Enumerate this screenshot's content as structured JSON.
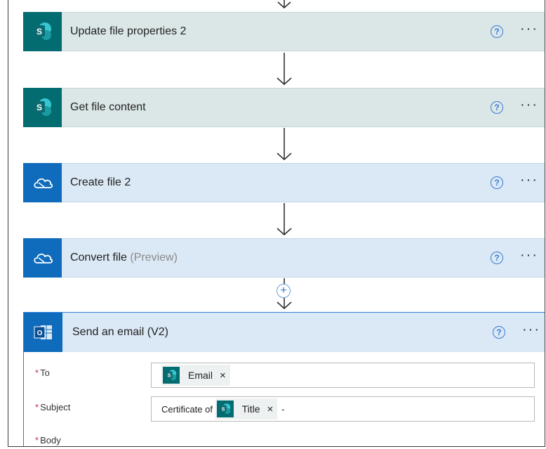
{
  "steps": [
    {
      "title": "Update file properties 2",
      "type": "sharepoint"
    },
    {
      "title": "Get file content",
      "type": "sharepoint"
    },
    {
      "title": "Create file 2",
      "type": "onedrive"
    },
    {
      "title": "Convert file",
      "suffix": "(Preview)",
      "type": "onedrive"
    }
  ],
  "help_glyph": "?",
  "more_glyph": "···",
  "add_glyph": "+",
  "email_step": {
    "title": "Send an email (V2)",
    "fields": {
      "to_label": "To",
      "subject_label": "Subject",
      "body_label": "Body",
      "required_mark": "*",
      "to_token": "Email",
      "subject_prefix": "Certificate of ",
      "subject_token": "Title",
      "subject_suffix": "-"
    }
  },
  "colors": {
    "sharepoint": "#036c70",
    "onedrive": "#0f6cbd",
    "accent": "#2e7bd6"
  }
}
